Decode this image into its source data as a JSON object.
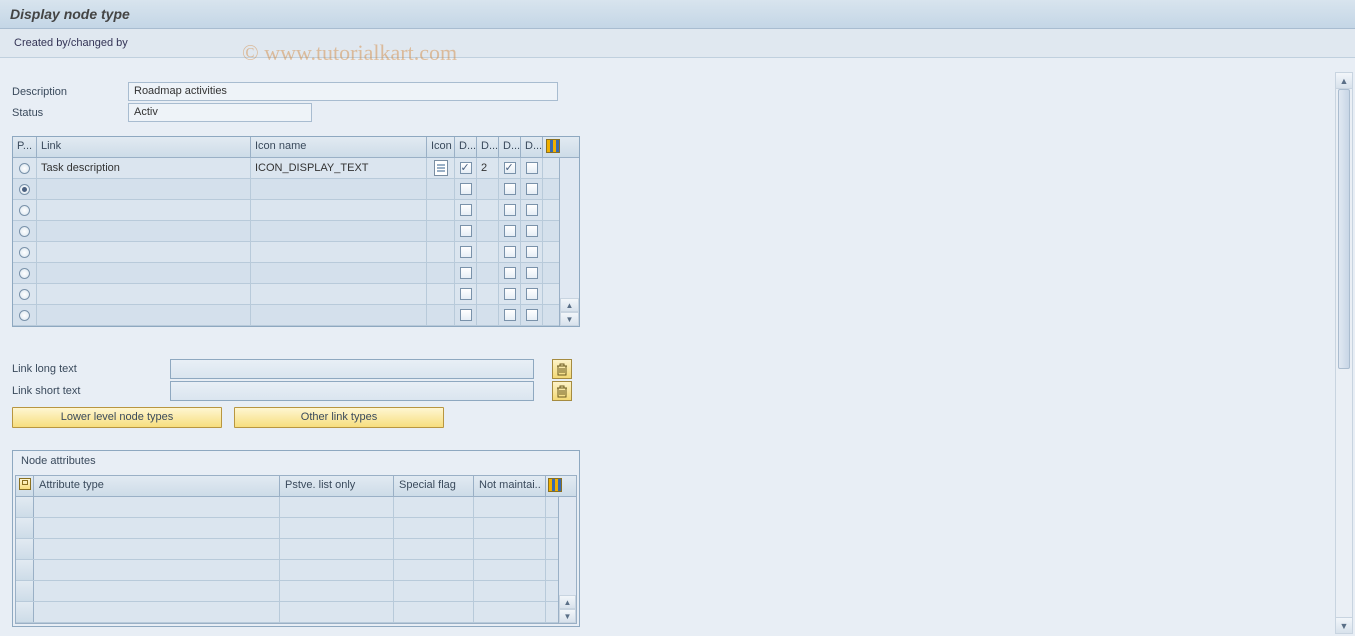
{
  "title": "Display node type",
  "toolbar": {
    "created_changed": "Created by/changed by"
  },
  "fields": {
    "description_label": "Description",
    "description_value": "Roadmap activities",
    "status_label": "Status",
    "status_value": "Activ"
  },
  "link_table": {
    "headers": {
      "p": "P...",
      "link": "Link",
      "icon_name": "Icon name",
      "icon": "Icon",
      "d1": "D...",
      "d2": "D...",
      "d3": "D...",
      "d4": "D..."
    },
    "rows": [
      {
        "selected": false,
        "link": "Task description",
        "icon_name": "ICON_DISPLAY_TEXT",
        "has_icon": true,
        "d1": true,
        "d2": "2",
        "d3": true,
        "d4": false
      },
      {
        "selected": true,
        "link": "",
        "icon_name": "",
        "has_icon": false,
        "d1": false,
        "d2": "",
        "d3": false,
        "d4": false
      },
      {
        "selected": false,
        "link": "",
        "icon_name": "",
        "has_icon": false,
        "d1": false,
        "d2": "",
        "d3": false,
        "d4": false
      },
      {
        "selected": false,
        "link": "",
        "icon_name": "",
        "has_icon": false,
        "d1": false,
        "d2": "",
        "d3": false,
        "d4": false
      },
      {
        "selected": false,
        "link": "",
        "icon_name": "",
        "has_icon": false,
        "d1": false,
        "d2": "",
        "d3": false,
        "d4": false
      },
      {
        "selected": false,
        "link": "",
        "icon_name": "",
        "has_icon": false,
        "d1": false,
        "d2": "",
        "d3": false,
        "d4": false
      },
      {
        "selected": false,
        "link": "",
        "icon_name": "",
        "has_icon": false,
        "d1": false,
        "d2": "",
        "d3": false,
        "d4": false
      },
      {
        "selected": false,
        "link": "",
        "icon_name": "",
        "has_icon": false,
        "d1": false,
        "d2": "",
        "d3": false,
        "d4": false
      }
    ]
  },
  "long_text": {
    "long_label": "Link long text",
    "short_label": "Link short text",
    "long_value": "",
    "short_value": ""
  },
  "buttons": {
    "lower_level": "Lower level node types",
    "other_link": "Other link types"
  },
  "attributes": {
    "title": "Node attributes",
    "headers": {
      "attr_type": "Attribute type",
      "pstve": "Pstve. list only",
      "special": "Special flag",
      "not_maint": "Not maintai.."
    },
    "rows": [
      {},
      {},
      {},
      {},
      {},
      {}
    ]
  },
  "watermark": "© www.tutorialkart.com"
}
